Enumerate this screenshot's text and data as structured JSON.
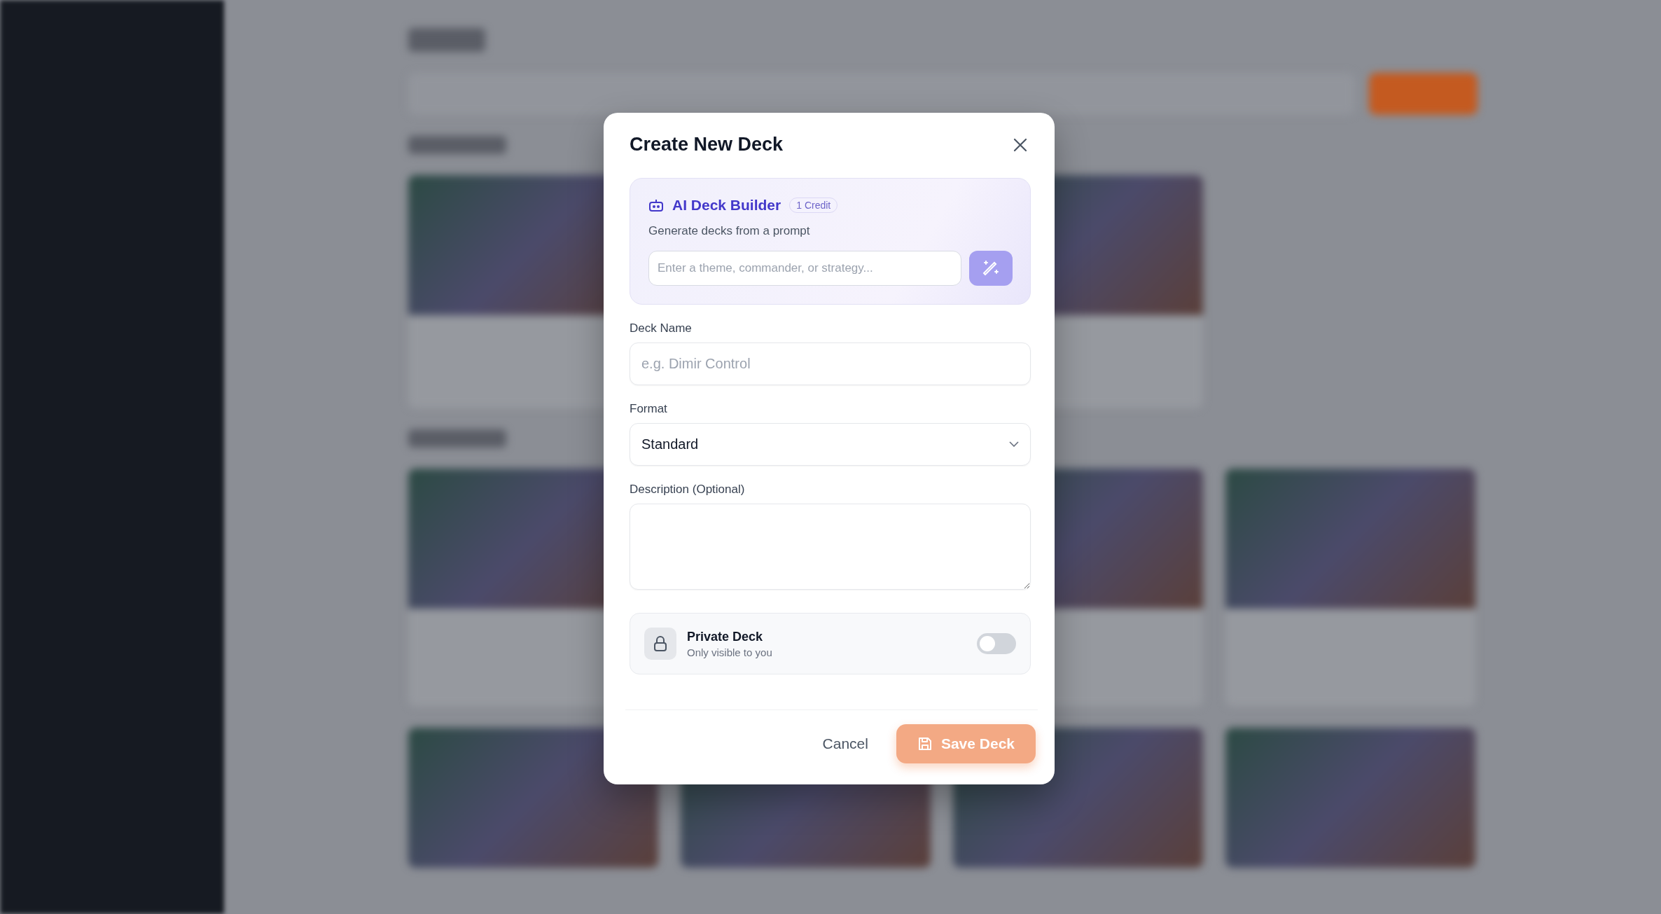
{
  "dialog": {
    "title": "Create New Deck",
    "ai_builder": {
      "title": "AI Deck Builder",
      "badge": "1 Credit",
      "subtitle": "Generate decks from a prompt",
      "prompt": {
        "placeholder": "Enter a theme, commander, or strategy..."
      }
    },
    "fields": [
      {
        "kind": "input",
        "label": "Deck Name",
        "placeholder": "e.g. Dimir Control"
      },
      {
        "kind": "select",
        "label": "Format",
        "value": "Standard"
      },
      {
        "kind": "textarea",
        "label": "Description (Optional)"
      }
    ],
    "private": {
      "title": "Private Deck",
      "subtitle": "Only visible to you",
      "on": false
    },
    "buttons": [
      {
        "kind": "cancel",
        "label": "Cancel",
        "disabled": false
      },
      {
        "kind": "save",
        "label": "Save Deck",
        "disabled": true
      }
    ]
  }
}
